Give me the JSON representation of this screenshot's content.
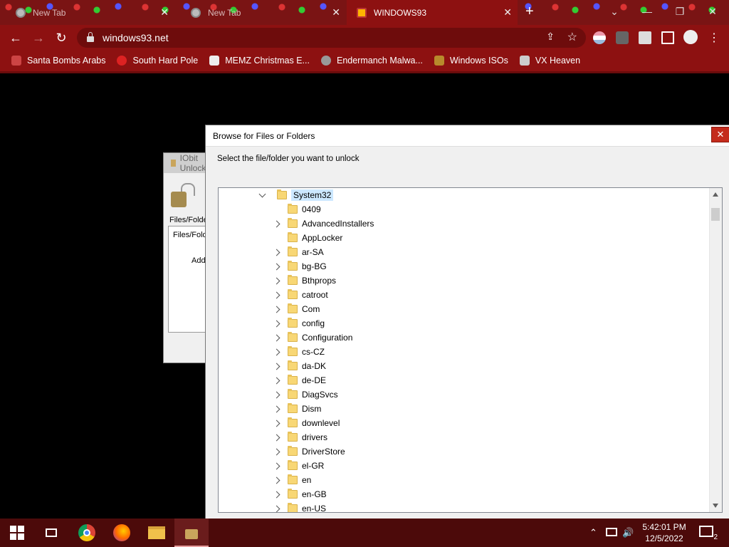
{
  "browser": {
    "tabs": [
      {
        "title": "New Tab",
        "active": false
      },
      {
        "title": "New Tab",
        "active": false
      },
      {
        "title": "WINDOWS93",
        "active": true
      }
    ],
    "url": "windows93.net",
    "bookmarks": [
      "Santa Bombs Arabs",
      "South Hard Pole",
      "MEMZ Christmas E...",
      "Endermanch Malwa...",
      "Windows ISOs",
      "VX Heaven"
    ],
    "colors": {
      "chrome": "#8d1111",
      "tabbar": "#7a1414"
    }
  },
  "background_window": {
    "title": "IObit Unlocker",
    "files_label": "Files/Folde",
    "files_col": "Files/Fold",
    "add_label": "Add"
  },
  "dialog": {
    "title": "Browse for Files or Folders",
    "close_label": "✕",
    "instruction": "Select the file/folder you want to unlock",
    "tree": {
      "root": "System32",
      "items": [
        {
          "name": "0409",
          "expandable": false
        },
        {
          "name": "AdvancedInstallers",
          "expandable": true
        },
        {
          "name": "AppLocker",
          "expandable": false
        },
        {
          "name": "ar-SA",
          "expandable": true
        },
        {
          "name": "bg-BG",
          "expandable": true
        },
        {
          "name": "Bthprops",
          "expandable": true
        },
        {
          "name": "catroot",
          "expandable": true
        },
        {
          "name": "Com",
          "expandable": true
        },
        {
          "name": "config",
          "expandable": true
        },
        {
          "name": "Configuration",
          "expandable": true
        },
        {
          "name": "cs-CZ",
          "expandable": true
        },
        {
          "name": "da-DK",
          "expandable": true
        },
        {
          "name": "de-DE",
          "expandable": true
        },
        {
          "name": "DiagSvcs",
          "expandable": true
        },
        {
          "name": "Dism",
          "expandable": true
        },
        {
          "name": "downlevel",
          "expandable": true
        },
        {
          "name": "drivers",
          "expandable": true
        },
        {
          "name": "DriverStore",
          "expandable": true
        },
        {
          "name": "el-GR",
          "expandable": true
        },
        {
          "name": "en",
          "expandable": true
        },
        {
          "name": "en-GB",
          "expandable": true
        },
        {
          "name": "en-US",
          "expandable": true
        }
      ]
    }
  },
  "taskbar": {
    "time": "5:42:01 PM",
    "date": "12/5/2022",
    "notification_count": "2"
  }
}
